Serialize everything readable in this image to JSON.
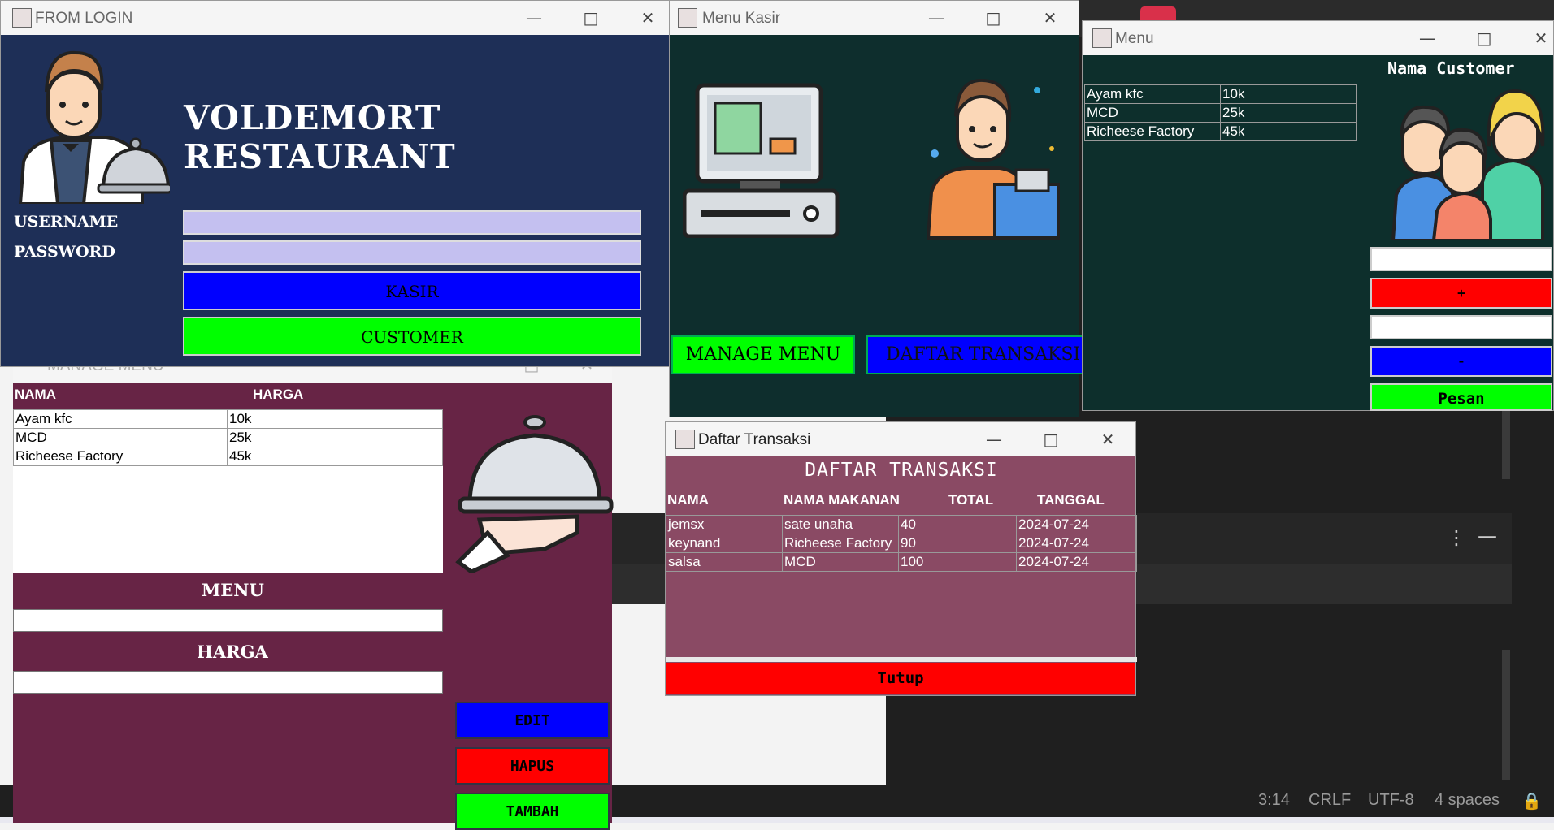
{
  "colors": {
    "login_bg": "#1e2f57",
    "kasir_bg": "#0e2e2d",
    "menu_bg": "#0d2f2c",
    "manage_bg": "#672445",
    "transaksi_bg": "#8a4a64",
    "blue": "#0000ff",
    "green": "#00ff00",
    "red": "#ff0000"
  },
  "login": {
    "title": "FROM LOGIN",
    "heading": "VOLDEMORT RESTAURANT",
    "username_label": "USERNAME",
    "password_label": "PASSWORD",
    "kasir_btn": "KASIR",
    "customer_btn": "CUSTOMER",
    "icon": "waiter-icon"
  },
  "kasir": {
    "title": "Menu Kasir",
    "manage_btn": "MANAGE MENU",
    "daftar_btn": "DAFTAR TRANSAKSI"
  },
  "customer": {
    "title": "Menu",
    "heading": "Nama Customer",
    "rows": [
      [
        "Ayam kfc",
        "10k"
      ],
      [
        "MCD",
        "25k"
      ],
      [
        "Richeese Factory",
        "45k"
      ]
    ],
    "plus_btn": "+",
    "minus_btn": "-",
    "pesan_btn": "Pesan"
  },
  "manage": {
    "title": "MANAGE MENU",
    "col_nama": "NAMA",
    "col_harga": "HARGA",
    "rows": [
      [
        "Ayam kfc",
        "10k"
      ],
      [
        "MCD",
        "25k"
      ],
      [
        "Richeese Factory",
        "45k"
      ]
    ],
    "menu_label": "MENU",
    "harga_label": "HARGA",
    "edit_btn": "EDIT",
    "hapus_btn": "HAPUS",
    "tambah_btn": "TAMBAH"
  },
  "transaksi": {
    "title": "Daftar Transaksi",
    "heading": "DAFTAR TRANSAKSI",
    "cols": [
      "NAMA",
      "NAMA MAKANAN",
      "TOTAL",
      "TANGGAL"
    ],
    "rows": [
      [
        "jemsx",
        "sate unaha",
        "40",
        "2024-07-24"
      ],
      [
        "keynand",
        "Richeese Factory",
        "90",
        "2024-07-24"
      ],
      [
        "salsa",
        "MCD",
        "100",
        "2024-07-24"
      ]
    ],
    "tutup_btn": "Tutup"
  },
  "editor": {
    "status": {
      "position": "3:14",
      "eol": "CRLF",
      "encoding": "UTF-8",
      "indent": "4 spaces"
    }
  }
}
